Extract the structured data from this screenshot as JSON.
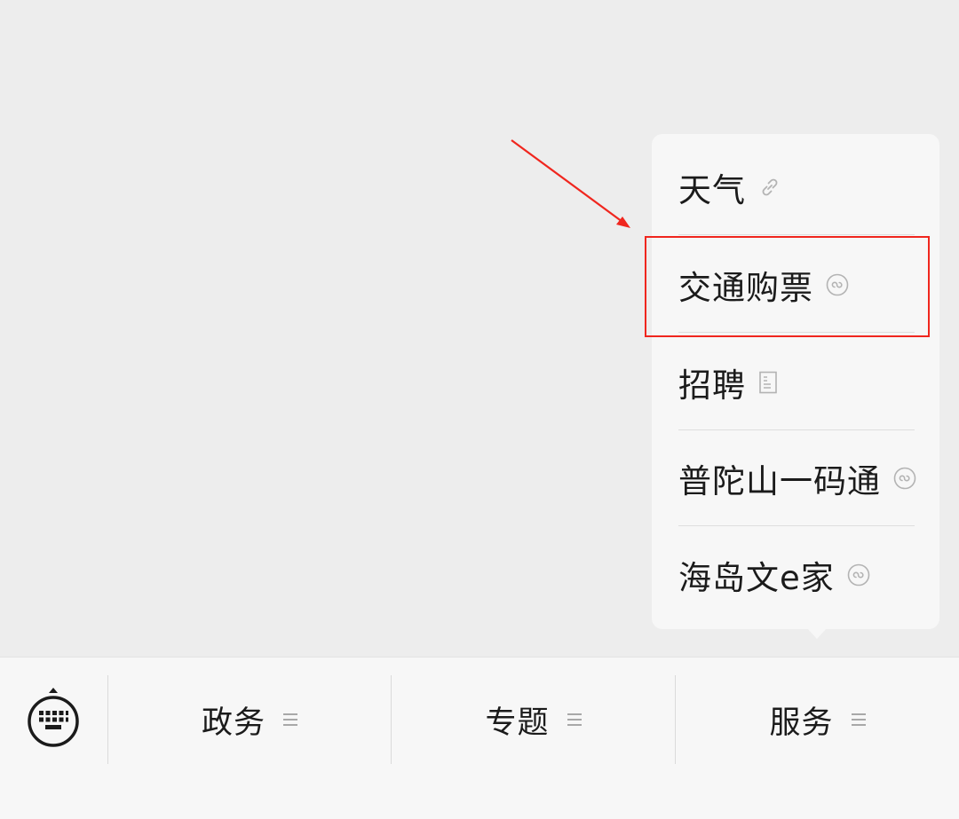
{
  "menu": {
    "items": [
      {
        "label": "天气",
        "icon": "link-icon"
      },
      {
        "label": "交通购票",
        "icon": "mini-program-icon"
      },
      {
        "label": "招聘",
        "icon": "article-icon"
      },
      {
        "label": "普陀山一码通",
        "icon": "mini-program-icon"
      },
      {
        "label": "海岛文e家",
        "icon": "mini-program-icon"
      }
    ],
    "highlighted_index": 1
  },
  "bottom_bar": {
    "keyboard_icon": "keyboard-icon",
    "tabs": [
      {
        "label": "政务",
        "icon": "menu-lines-icon"
      },
      {
        "label": "专题",
        "icon": "menu-lines-icon"
      },
      {
        "label": "服务",
        "icon": "menu-lines-icon"
      }
    ]
  },
  "colors": {
    "annotation": "#f0261e",
    "background": "#ededed",
    "panel": "#f7f7f7",
    "text": "#1b1b1b",
    "icon": "#b3b3b3"
  }
}
